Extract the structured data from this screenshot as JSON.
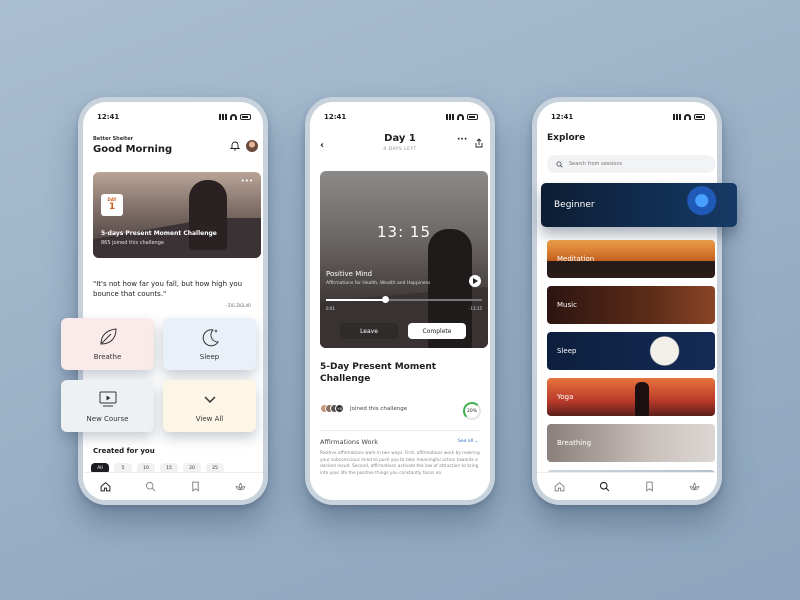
{
  "status_time": "12:41",
  "home": {
    "subtitle": "Better Shelter",
    "greeting": "Good Morning",
    "challenge": {
      "day_label": "DAY",
      "day_number": "1",
      "title": "5-days Present Moment Challenge",
      "joined": "865 joined this challenge"
    },
    "quote": "\"It's not how far you fall, but how high you bounce that counts.\"",
    "quote_author": "- ZIG ZIGLAR",
    "cards": {
      "breathe": "Breathe",
      "sleep": "Sleep",
      "new_course": "New Course",
      "view_all": "View All"
    },
    "created_for_you": "Created for you",
    "chips": [
      "All",
      "5",
      "10",
      "15",
      "20",
      "25"
    ]
  },
  "detail": {
    "title": "Day 1",
    "subtitle": "4 DAYS LEFT",
    "timer": "13: 15",
    "track_title": "Positive Mind",
    "track_subtitle": "Affirmations for Health, Wealth and Happiness",
    "time_start": "0:01",
    "time_end": "-13:15",
    "progress": 0.37,
    "leave": "Leave",
    "complete": "Complete",
    "heading": "5-Day Present Moment Challenge",
    "joined": "Joined this challenge",
    "avatar_more": "+8",
    "percent": "20%",
    "section_title": "Affirmations Work",
    "see_all": "See all",
    "paragraph": "Positive affirmations work in two ways. First, affirmations work by rewiring your subconscious mind to push you to take meaningful action towards a desired result. Second, affirmations activate the law of attraction to bring into your life the positive things you constantly focus on."
  },
  "explore": {
    "title": "Explore",
    "search_placeholder": "Search from sessions",
    "categories": {
      "beginner": "Beginner",
      "meditation": "Meditation",
      "music": "Music",
      "sleep": "Sleep",
      "yoga": "Yoga",
      "breathing": "Breathing"
    }
  }
}
